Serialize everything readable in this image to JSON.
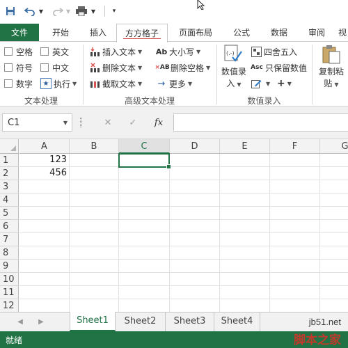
{
  "tabs": [
    {
      "label": "文件"
    },
    {
      "label": "开始"
    },
    {
      "label": "插入"
    },
    {
      "label": "方方格子"
    },
    {
      "label": "页面布局"
    },
    {
      "label": "公式"
    },
    {
      "label": "数据"
    },
    {
      "label": "审阅"
    },
    {
      "label": "视"
    }
  ],
  "ribbon": {
    "text_processing": {
      "checkboxes": [
        "空格",
        "英文",
        "符号",
        "中文",
        "数字"
      ],
      "execute_label": "执行",
      "group_label": "文本处理"
    },
    "advanced_text": {
      "items": [
        "插入文本",
        "大小写",
        "删除文本",
        "删除空格",
        "截取文本",
        "更多"
      ],
      "group_label": "高级文本处理"
    },
    "data_entry": {
      "big_button_line1": "数值录",
      "big_button_line2": "入",
      "round_label": "四舍五入",
      "keep_values_label": "只保留数值",
      "plus_label": "+",
      "group_label": "数值录入"
    },
    "paste": {
      "line1": "复制粘",
      "line2": "贴"
    }
  },
  "formula_bar": {
    "name_box": "C1",
    "fx_label": "fx",
    "formula": ""
  },
  "grid": {
    "columns": [
      "A",
      "B",
      "C",
      "D",
      "E",
      "F",
      "G"
    ],
    "rows": [
      "1",
      "2",
      "3",
      "4",
      "5",
      "6",
      "7",
      "8",
      "9",
      "10",
      "11",
      "12"
    ],
    "cells": {
      "A1": "123",
      "A2": "456"
    },
    "active_column": "C",
    "active_cell": "C1"
  },
  "sheets": [
    "Sheet1",
    "Sheet2",
    "Sheet3",
    "Sheet4"
  ],
  "active_sheet": "Sheet1",
  "status": "就绪",
  "watermark": {
    "url": "jb51.net",
    "brand": "脚本之家"
  },
  "colors": {
    "excel_green": "#217346",
    "underline_red": "#d9534f"
  }
}
